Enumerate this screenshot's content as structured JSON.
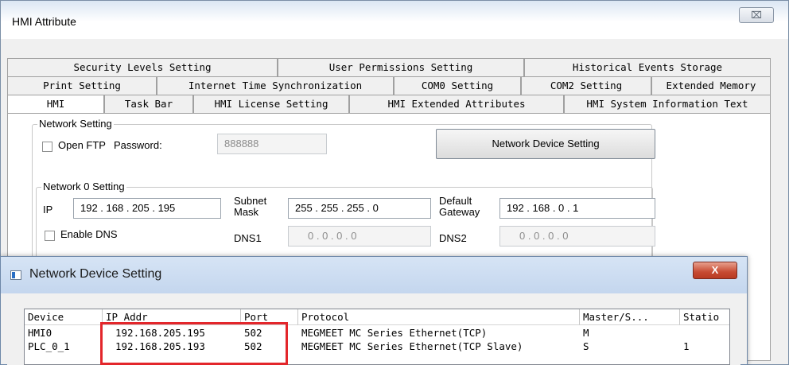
{
  "main_window": {
    "title": "HMI Attribute",
    "close_glyph": "⌧"
  },
  "tabs": {
    "row1": [
      "Security Levels Setting",
      "User Permissions Setting",
      "Historical Events Storage"
    ],
    "row2": [
      "Print Setting",
      "Internet Time Synchronization",
      "COM0 Setting",
      "COM2 Setting",
      "Extended Memory"
    ],
    "row3": [
      "HMI",
      "Task Bar",
      "HMI License Setting",
      "HMI Extended Attributes",
      "HMI System Information Text"
    ],
    "active": "HMI"
  },
  "network_setting": {
    "group_title": "Network Setting",
    "open_ftp_label": "Open FTP",
    "open_ftp_checked": false,
    "password_label": "Password:",
    "password_value": "888888",
    "network_device_button": "Network Device Setting"
  },
  "network0": {
    "group_title": "Network 0 Setting",
    "ip_label": "IP",
    "ip_value": "192 . 168 . 205 . 195",
    "subnet_label_1": "Subnet",
    "subnet_label_2": "Mask",
    "subnet_value": "255 . 255 . 255 .   0",
    "gateway_label_1": "Default",
    "gateway_label_2": "Gateway",
    "gateway_value": "192 . 168 .   0  .   1",
    "enable_dns_label": "Enable DNS",
    "enable_dns_checked": false,
    "dns1_label": "DNS1",
    "dns1_value": "0   .   0   .   0   .   0",
    "dns2_label": "DNS2",
    "dns2_value": "0   .   0   .   0   .   0"
  },
  "sub_window": {
    "title": "Network Device Setting",
    "close_glyph": "X"
  },
  "device_table": {
    "columns": [
      "Device",
      "IP Addr",
      "Port",
      "Protocol",
      "Master/S...",
      "Statio"
    ],
    "rows": [
      [
        "HMI0",
        "192.168.205.195",
        "502",
        "MEGMEET MC Series Ethernet(TCP)",
        "M",
        ""
      ],
      [
        "PLC_0_1",
        "192.168.205.193",
        "502",
        "MEGMEET MC Series Ethernet(TCP Slave)",
        "S",
        "1"
      ]
    ]
  },
  "colors": {
    "highlight": "#e3262b",
    "close_button": "#c74a32"
  }
}
